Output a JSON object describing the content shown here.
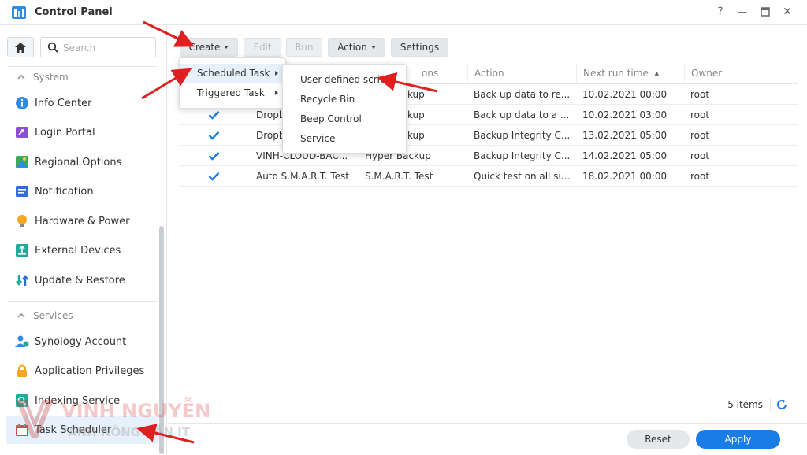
{
  "window": {
    "title": "Control Panel",
    "controls": {
      "help": "?",
      "minimize": "—",
      "maximize": "□",
      "close": "✕"
    }
  },
  "sidebar": {
    "search_placeholder": "Search",
    "sections": [
      {
        "label": "System"
      },
      {
        "label": "Services"
      }
    ],
    "items": [
      {
        "label": "Info Center",
        "icon": "info-icon"
      },
      {
        "label": "Login Portal",
        "icon": "login-portal-icon"
      },
      {
        "label": "Regional Options",
        "icon": "regional-options-icon"
      },
      {
        "label": "Notification",
        "icon": "notification-icon"
      },
      {
        "label": "Hardware & Power",
        "icon": "lightbulb-icon"
      },
      {
        "label": "External Devices",
        "icon": "external-device-icon"
      },
      {
        "label": "Update & Restore",
        "icon": "update-icon"
      },
      {
        "label": "Synology Account",
        "icon": "user-cloud-icon"
      },
      {
        "label": "Application Privileges",
        "icon": "lock-icon"
      },
      {
        "label": "Indexing Service",
        "icon": "indexing-icon"
      },
      {
        "label": "Task Scheduler",
        "icon": "calendar-icon",
        "active": true
      }
    ]
  },
  "toolbar": {
    "create": "Create",
    "edit": "Edit",
    "run": "Run",
    "action": "Action",
    "settings": "Settings"
  },
  "table": {
    "columns": [
      "ons",
      "Action",
      "Next run time",
      "Owner"
    ],
    "sort_indicator": "▲",
    "rows": [
      {
        "enabled": true,
        "name": "",
        "app": "ackup",
        "action": "Back up data to re...",
        "next_run": "10.02.2021 00:00",
        "owner": "root"
      },
      {
        "enabled": true,
        "name": "Dropb",
        "app": "ackup",
        "action": "Back up data to a ...",
        "next_run": "10.02.2021 03:00",
        "owner": "root"
      },
      {
        "enabled": true,
        "name": "Dropb",
        "app": "ackup",
        "action": "Backup Integrity C...",
        "next_run": "13.02.2021 05:00",
        "owner": "root"
      },
      {
        "enabled": true,
        "name": "VINH-CLOUD-BAC...",
        "app": "Hyper Backup",
        "action": "Backup Integrity C...",
        "next_run": "14.02.2021 05:00",
        "owner": "root"
      },
      {
        "enabled": true,
        "name": "Auto S.M.A.R.T. Test",
        "app": "S.M.A.R.T. Test",
        "action": "Quick test on all su...",
        "next_run": "18.02.2021 00:00",
        "owner": "root"
      }
    ]
  },
  "create_menu": {
    "items": [
      {
        "label": "Scheduled Task",
        "has_submenu": true
      },
      {
        "label": "Triggered Task",
        "has_submenu": true
      }
    ]
  },
  "scheduled_submenu": {
    "items": [
      {
        "label": "User-defined scrip"
      },
      {
        "label": "Recycle Bin"
      },
      {
        "label": "Beep Control"
      },
      {
        "label": "Service"
      }
    ]
  },
  "footer": {
    "item_count": "5 items",
    "reset": "Reset",
    "apply": "Apply"
  },
  "watermark": {
    "text": "VINH NGUYỄN",
    "subtext": "ANH NÔNG DÂN IT"
  },
  "colors": {
    "accent": "#1a7ce7",
    "check": "#1a7ce7",
    "arrow": "#e02020"
  }
}
